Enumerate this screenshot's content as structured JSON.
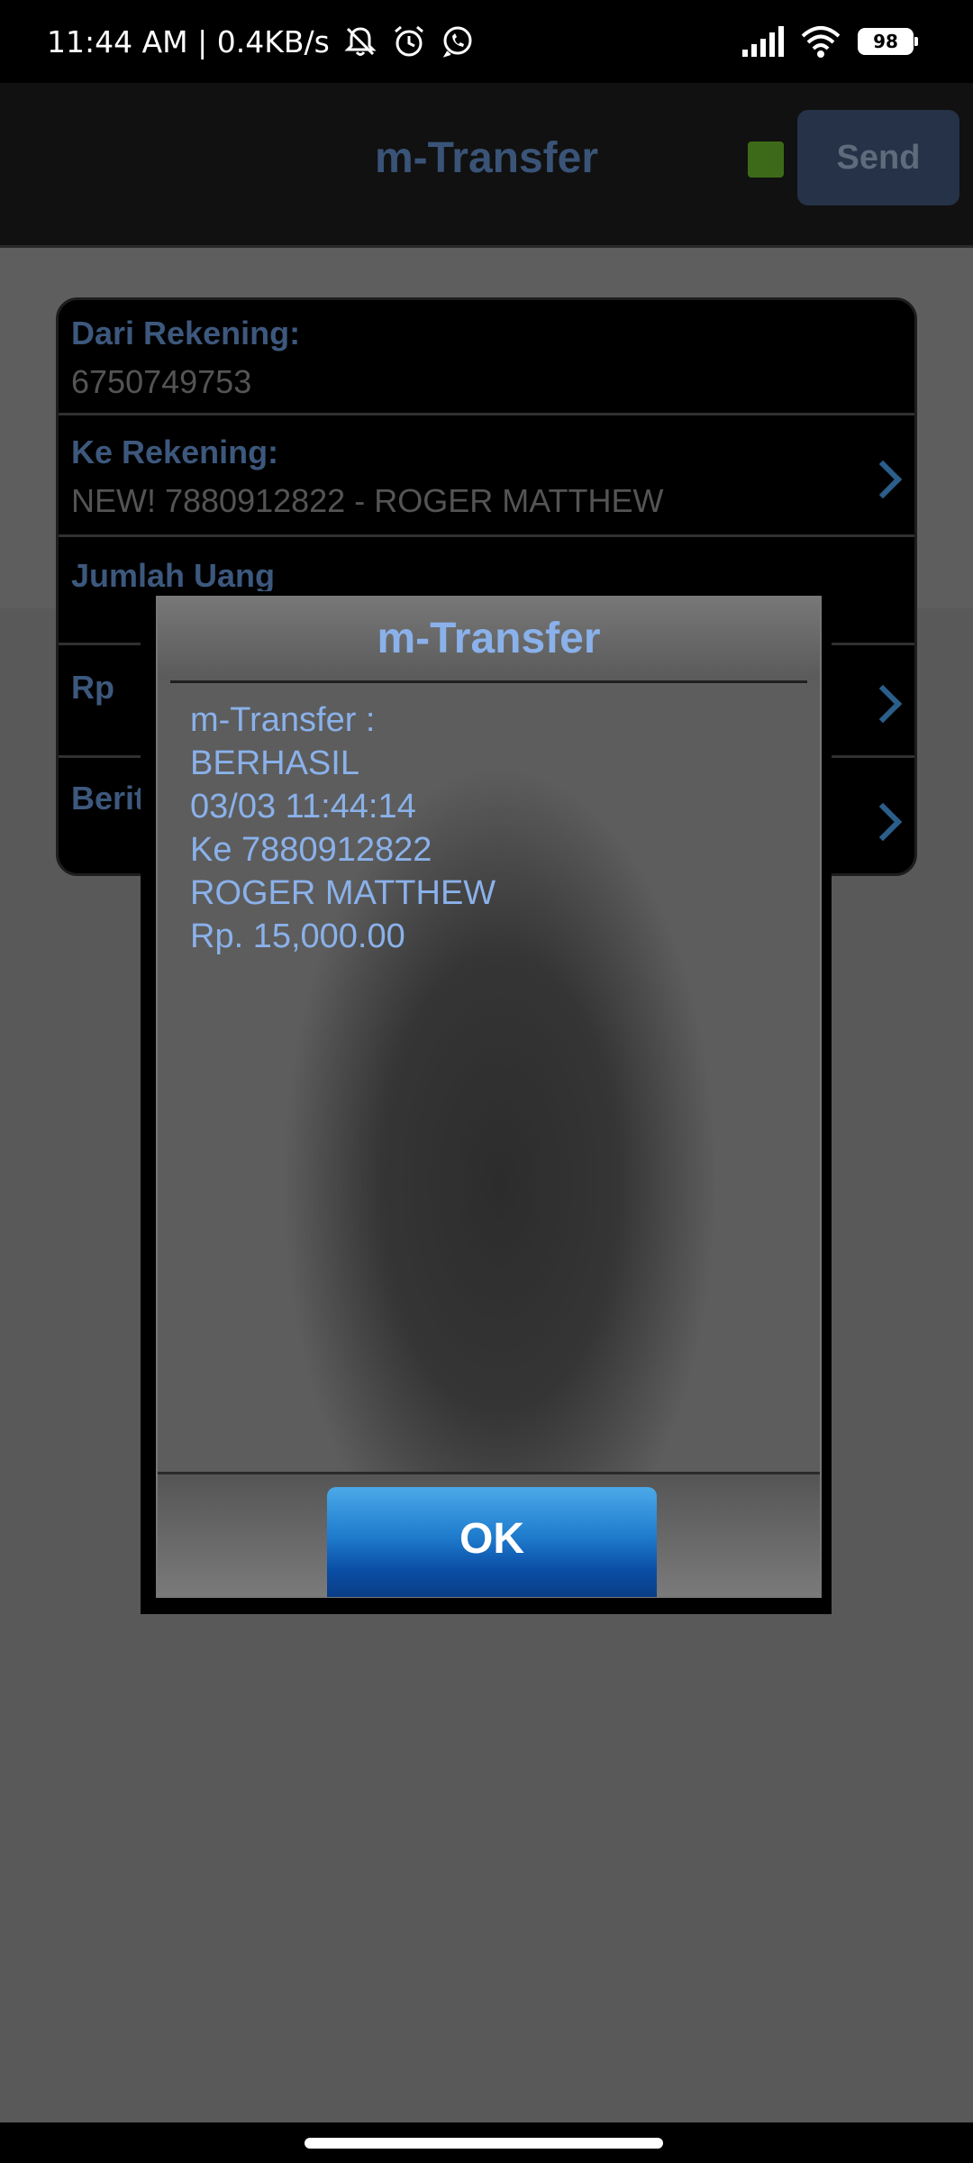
{
  "status_bar": {
    "time_speed": "11:44 AM | 0.4KB/s",
    "icons": [
      "bell-off-icon",
      "alarm-icon",
      "whatsapp-icon"
    ],
    "right_icons": [
      "signal-icon",
      "wifi-icon",
      "battery-icon"
    ],
    "battery": "98"
  },
  "header": {
    "title": "m-Transfer",
    "send_label": "Send",
    "indicator_color": "#3d6a18"
  },
  "form": {
    "rows": [
      {
        "label": "Dari Rekening:",
        "value": "6750749753"
      },
      {
        "label": "Ke Rekening:",
        "value": "NEW! 7880912822 - ROGER MATTHEW"
      },
      {
        "label": "Jumlah Uang",
        "value": ""
      },
      {
        "label": "Rp",
        "value": ""
      },
      {
        "label": "Berit",
        "value": ""
      }
    ]
  },
  "dialog": {
    "title": "m-Transfer",
    "message_lines": [
      "m-Transfer :",
      "BERHASIL",
      "03/03 11:44:14",
      "Ke 7880912822",
      "ROGER MATTHEW",
      "Rp. 15,000.00"
    ],
    "ok_label": "OK"
  },
  "colors": {
    "accent": "#8ab1ea",
    "ok_button": "#1f7ccd"
  }
}
